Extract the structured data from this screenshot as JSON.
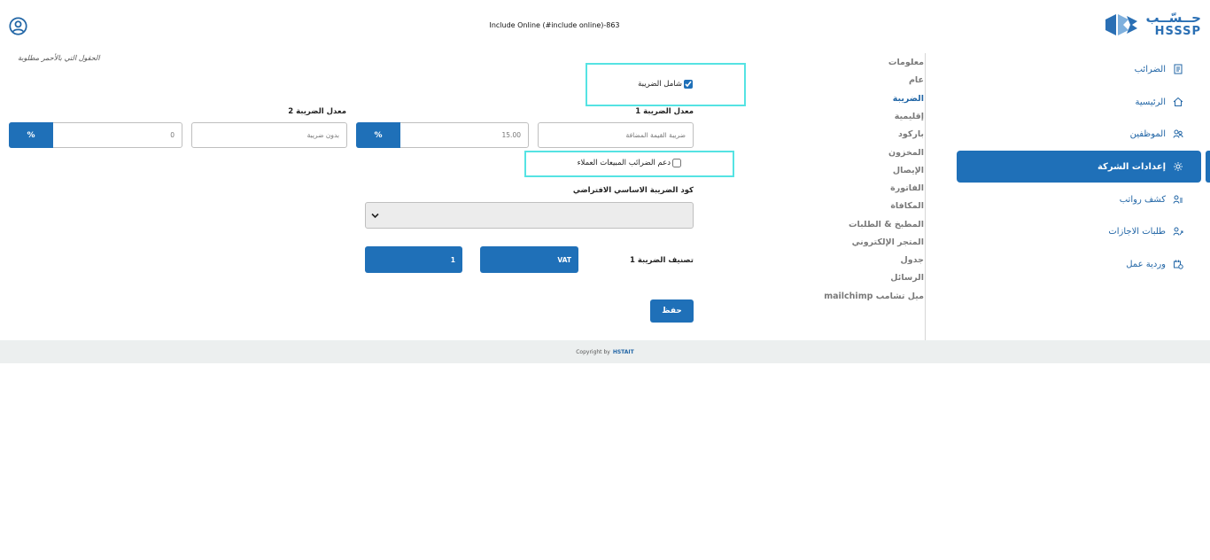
{
  "header": {
    "logo_ar": "حــسّــب",
    "logo_en": "HSSSP",
    "title": "Include Online (#include online)-863"
  },
  "sidebar": {
    "items": [
      {
        "label": "الضرائب",
        "icon": "receipt-icon"
      },
      {
        "label": "الرئيسية",
        "icon": "home-icon"
      },
      {
        "label": "الموظفين",
        "icon": "users-icon"
      },
      {
        "label": "إعدادات الشركة",
        "icon": "gear-icon"
      },
      {
        "label": "كشف رواتب",
        "icon": "payroll-icon"
      },
      {
        "label": "طلبات الاجازات",
        "icon": "leave-icon"
      },
      {
        "label": "وردية عمل",
        "icon": "shift-icon"
      }
    ]
  },
  "subnav": {
    "items": [
      "معلومات",
      "عام",
      "الضريبة",
      "إقليمية",
      "باركود",
      "المخزون",
      "الإيصال",
      "الفاتورة",
      "المكافاة",
      "المطبخ & الطلبات",
      "المتجر الإلكتروني",
      "جدول",
      "الرسائل",
      "mailchimp ميل تشامب"
    ]
  },
  "form": {
    "required_note": "الحقول التي بالأحمر مطلوبة",
    "tax_inclusive_label": "شامل الضريبة",
    "tax_rate1_label": "معدل الضريبة 1",
    "tax_rate2_label": "معدل الضريبة 2",
    "tax1_name_placeholder": "ضريبة القيمة المضافة",
    "tax1_value": "15.00",
    "tax2_name_placeholder": "بدون ضريبة",
    "tax2_value": "0",
    "pct": "%",
    "customer_sales_tax_label": "دعم الضرائب المبيعات العملاء",
    "default_tax_code_label": "كود الضريبة الاساسي الافتراضي",
    "tax_class_label": "تصنيف الضريبة 1",
    "tax_class_btn1": "VAT",
    "tax_class_btn2": "1",
    "save_label": "حفظ"
  },
  "footer": {
    "copyright": "Copyright by",
    "brand": "HSTAIT"
  }
}
